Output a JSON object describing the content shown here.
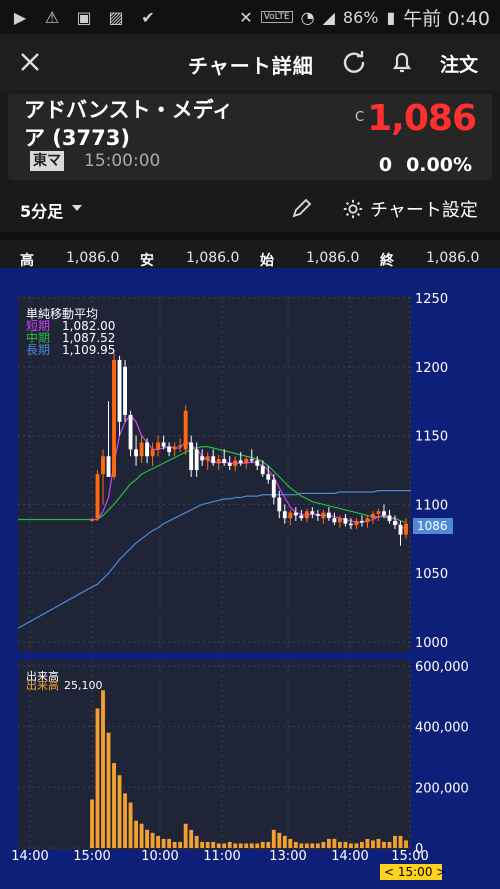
{
  "status_bar": {
    "battery": "86%",
    "time": "午前 0:40",
    "volte": "VoLTE"
  },
  "header": {
    "title": "チャート詳細",
    "order_label": "注文"
  },
  "stock": {
    "name": "アドバンスト・メディア (3773)",
    "market": "東マ",
    "time": "15:00:00",
    "price_flag": "C",
    "price": "1,086",
    "change": "0",
    "change_pct": "0.00%"
  },
  "toolbar": {
    "interval": "5分足",
    "settings_label": "チャート設定"
  },
  "ohlc": {
    "high_label": "高",
    "high": "1,086.0",
    "low_label": "安",
    "low": "1,086.0",
    "open_label": "始",
    "open": "1,086.0",
    "close_label": "終",
    "close": "1,086.0"
  },
  "legend": {
    "title": "単純移動平均",
    "short_label": "短期",
    "short_value": "1,082.00",
    "mid_label": "中期",
    "mid_value": "1,087.52",
    "long_label": "長期",
    "long_value": "1,109.95"
  },
  "volume_legend": {
    "title": "出来高",
    "label": "出来高",
    "value": "25,100"
  },
  "colors": {
    "bg_chart": "#0e1f7a",
    "panel": "#1f2436",
    "up": "#ff6a10",
    "down": "#ffffff",
    "sma_short": "#d040ff",
    "sma_mid": "#20c040",
    "sma_long": "#4d8ad8",
    "volume": "#f2a030",
    "price_red": "#ff3030"
  },
  "chart_data": {
    "type": "candlestick",
    "y_ticks": [
      "1250",
      "1200",
      "1150",
      "1100",
      "1050",
      "1000"
    ],
    "ylim": [
      1000,
      1250
    ],
    "last_price_label": "1086",
    "x_ticks": [
      "14:00",
      "15:00",
      "10:00",
      "11:00",
      "13:00",
      "14:00",
      "15:00"
    ],
    "current_time_label": "< 15:00 >",
    "volume_ticks": [
      "600,000",
      "400,000",
      "200,000",
      "0"
    ],
    "volume_ylim": [
      0,
      600000
    ],
    "candles": [
      {
        "o": 1089,
        "h": 1090,
        "l": 1088,
        "c": 1089
      },
      {
        "o": 1090,
        "h": 1125,
        "l": 1088,
        "c": 1122
      },
      {
        "o": 1122,
        "h": 1140,
        "l": 1100,
        "c": 1135
      },
      {
        "o": 1135,
        "h": 1175,
        "l": 1130,
        "c": 1120
      },
      {
        "o": 1120,
        "h": 1210,
        "l": 1118,
        "c": 1205
      },
      {
        "o": 1205,
        "h": 1208,
        "l": 1150,
        "c": 1160
      },
      {
        "o": 1200,
        "h": 1205,
        "l": 1160,
        "c": 1165
      },
      {
        "o": 1165,
        "h": 1168,
        "l": 1135,
        "c": 1140
      },
      {
        "o": 1140,
        "h": 1150,
        "l": 1128,
        "c": 1135
      },
      {
        "o": 1135,
        "h": 1150,
        "l": 1130,
        "c": 1145
      },
      {
        "o": 1145,
        "h": 1148,
        "l": 1130,
        "c": 1135
      },
      {
        "o": 1135,
        "h": 1145,
        "l": 1128,
        "c": 1140
      },
      {
        "o": 1140,
        "h": 1150,
        "l": 1135,
        "c": 1145
      },
      {
        "o": 1145,
        "h": 1150,
        "l": 1140,
        "c": 1142
      },
      {
        "o": 1142,
        "h": 1145,
        "l": 1135,
        "c": 1138
      },
      {
        "o": 1140,
        "h": 1145,
        "l": 1135,
        "c": 1142
      },
      {
        "o": 1142,
        "h": 1148,
        "l": 1138,
        "c": 1143
      },
      {
        "o": 1140,
        "h": 1172,
        "l": 1136,
        "c": 1168
      },
      {
        "o": 1145,
        "h": 1150,
        "l": 1120,
        "c": 1125
      },
      {
        "o": 1140,
        "h": 1145,
        "l": 1120,
        "c": 1125
      },
      {
        "o": 1135,
        "h": 1140,
        "l": 1128,
        "c": 1132
      },
      {
        "o": 1132,
        "h": 1138,
        "l": 1125,
        "c": 1135
      },
      {
        "o": 1135,
        "h": 1140,
        "l": 1128,
        "c": 1130
      },
      {
        "o": 1130,
        "h": 1136,
        "l": 1125,
        "c": 1133
      },
      {
        "o": 1133,
        "h": 1140,
        "l": 1128,
        "c": 1130
      },
      {
        "o": 1130,
        "h": 1135,
        "l": 1125,
        "c": 1128
      },
      {
        "o": 1128,
        "h": 1135,
        "l": 1124,
        "c": 1132
      },
      {
        "o": 1132,
        "h": 1138,
        "l": 1128,
        "c": 1130
      },
      {
        "o": 1130,
        "h": 1135,
        "l": 1126,
        "c": 1133
      },
      {
        "o": 1133,
        "h": 1140,
        "l": 1130,
        "c": 1132
      },
      {
        "o": 1132,
        "h": 1135,
        "l": 1125,
        "c": 1128
      },
      {
        "o": 1128,
        "h": 1132,
        "l": 1120,
        "c": 1122
      },
      {
        "o": 1122,
        "h": 1128,
        "l": 1115,
        "c": 1118
      },
      {
        "o": 1118,
        "h": 1122,
        "l": 1100,
        "c": 1105
      },
      {
        "o": 1105,
        "h": 1110,
        "l": 1090,
        "c": 1095
      },
      {
        "o": 1095,
        "h": 1100,
        "l": 1086,
        "c": 1090
      },
      {
        "o": 1090,
        "h": 1096,
        "l": 1085,
        "c": 1094
      },
      {
        "o": 1094,
        "h": 1098,
        "l": 1088,
        "c": 1092
      },
      {
        "o": 1092,
        "h": 1096,
        "l": 1088,
        "c": 1090
      },
      {
        "o": 1090,
        "h": 1097,
        "l": 1087,
        "c": 1095
      },
      {
        "o": 1095,
        "h": 1098,
        "l": 1090,
        "c": 1093
      },
      {
        "o": 1093,
        "h": 1096,
        "l": 1088,
        "c": 1092
      },
      {
        "o": 1090,
        "h": 1096,
        "l": 1086,
        "c": 1094
      },
      {
        "o": 1094,
        "h": 1098,
        "l": 1088,
        "c": 1090
      },
      {
        "o": 1090,
        "h": 1094,
        "l": 1085,
        "c": 1087
      },
      {
        "o": 1087,
        "h": 1092,
        "l": 1083,
        "c": 1090
      },
      {
        "o": 1090,
        "h": 1093,
        "l": 1084,
        "c": 1086
      },
      {
        "o": 1086,
        "h": 1090,
        "l": 1082,
        "c": 1085
      },
      {
        "o": 1085,
        "h": 1090,
        "l": 1082,
        "c": 1088
      },
      {
        "o": 1088,
        "h": 1092,
        "l": 1084,
        "c": 1087
      },
      {
        "o": 1087,
        "h": 1092,
        "l": 1083,
        "c": 1090
      },
      {
        "o": 1090,
        "h": 1095,
        "l": 1086,
        "c": 1093
      },
      {
        "o": 1093,
        "h": 1097,
        "l": 1088,
        "c": 1095
      },
      {
        "o": 1095,
        "h": 1100,
        "l": 1090,
        "c": 1092
      },
      {
        "o": 1092,
        "h": 1096,
        "l": 1086,
        "c": 1088
      },
      {
        "o": 1088,
        "h": 1092,
        "l": 1082,
        "c": 1085
      },
      {
        "o": 1085,
        "h": 1088,
        "l": 1070,
        "c": 1078
      },
      {
        "o": 1078,
        "h": 1090,
        "l": 1075,
        "c": 1086
      }
    ],
    "sma_short": [
      1089,
      1089,
      1095,
      1105,
      1130,
      1150,
      1160,
      1165,
      1160,
      1150,
      1145,
      1140,
      1140,
      1141,
      1142,
      1141,
      1141,
      1146,
      1143,
      1140,
      1135,
      1132,
      1131,
      1130,
      1131,
      1130,
      1130,
      1130,
      1130,
      1131,
      1130,
      1128,
      1125,
      1120,
      1112,
      1105,
      1098,
      1094,
      1093,
      1092,
      1093,
      1092,
      1092,
      1092,
      1091,
      1090,
      1089,
      1088,
      1087,
      1087,
      1088,
      1089,
      1091,
      1092,
      1091,
      1089,
      1084,
      1082
    ],
    "sma_mid": [
      1089,
      1089,
      1092,
      1096,
      1100,
      1105,
      1110,
      1115,
      1118,
      1122,
      1124,
      1126,
      1128,
      1130,
      1132,
      1134,
      1136,
      1138,
      1140,
      1141,
      1142,
      1142,
      1141,
      1140,
      1139,
      1138,
      1137,
      1136,
      1135,
      1134,
      1133,
      1131,
      1128,
      1124,
      1120,
      1116,
      1112,
      1109,
      1106,
      1104,
      1102,
      1101,
      1100,
      1099,
      1098,
      1097,
      1096,
      1095,
      1094,
      1093,
      1092,
      1091,
      1091,
      1091,
      1090,
      1090,
      1088,
      1087
    ],
    "sma_long": [
      1040,
      1042,
      1046,
      1050,
      1055,
      1060,
      1064,
      1068,
      1072,
      1075,
      1078,
      1081,
      1083,
      1086,
      1088,
      1090,
      1092,
      1094,
      1096,
      1098,
      1100,
      1101,
      1102,
      1103,
      1104,
      1104,
      1105,
      1105,
      1106,
      1106,
      1106,
      1107,
      1107,
      1107,
      1107,
      1107,
      1107,
      1107,
      1108,
      1108,
      1108,
      1108,
      1108,
      1108,
      1108,
      1109,
      1109,
      1109,
      1109,
      1109,
      1109,
      1109,
      1110,
      1110,
      1110,
      1110,
      1110,
      1110
    ],
    "volumes": [
      160000,
      460000,
      520000,
      380000,
      280000,
      240000,
      180000,
      150000,
      90000,
      80000,
      60000,
      50000,
      40000,
      30000,
      30000,
      20000,
      20000,
      80000,
      60000,
      40000,
      20000,
      20000,
      20000,
      15000,
      15000,
      20000,
      15000,
      15000,
      15000,
      15000,
      15000,
      20000,
      20000,
      60000,
      50000,
      40000,
      30000,
      20000,
      15000,
      15000,
      15000,
      15000,
      20000,
      30000,
      30000,
      20000,
      20000,
      15000,
      15000,
      20000,
      30000,
      25000,
      30000,
      20000,
      20000,
      40000,
      40000,
      25100
    ]
  }
}
